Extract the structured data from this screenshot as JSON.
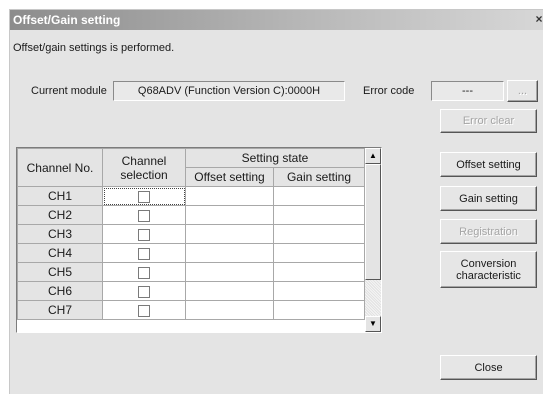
{
  "window": {
    "title": "Offset/Gain setting",
    "close_glyph": "×"
  },
  "description": "Offset/gain settings is performed.",
  "current_module": {
    "label": "Current module",
    "value": "Q68ADV (Function Version C):0000H"
  },
  "error_code": {
    "label": "Error code",
    "value": "---",
    "browse_label": "..."
  },
  "buttons": {
    "error_clear": "Error clear",
    "offset_setting": "Offset setting",
    "gain_setting": "Gain setting",
    "registration": "Registration",
    "conversion_characteristic": "Conversion\ncharacteristic",
    "close": "Close"
  },
  "grid": {
    "headers": {
      "channel_no": "Channel No.",
      "channel_selection": "Channel\nselection",
      "setting_state": "Setting state",
      "offset_setting": "Offset setting",
      "gain_setting": "Gain setting"
    },
    "rows": [
      {
        "channel": "CH1",
        "selected": false,
        "offset": "",
        "gain": ""
      },
      {
        "channel": "CH2",
        "selected": false,
        "offset": "",
        "gain": ""
      },
      {
        "channel": "CH3",
        "selected": false,
        "offset": "",
        "gain": ""
      },
      {
        "channel": "CH4",
        "selected": false,
        "offset": "",
        "gain": ""
      },
      {
        "channel": "CH5",
        "selected": false,
        "offset": "",
        "gain": ""
      },
      {
        "channel": "CH6",
        "selected": false,
        "offset": "",
        "gain": ""
      },
      {
        "channel": "CH7",
        "selected": false,
        "offset": "",
        "gain": ""
      }
    ]
  },
  "scrollbar": {
    "up_glyph": "▲",
    "down_glyph": "▼"
  }
}
